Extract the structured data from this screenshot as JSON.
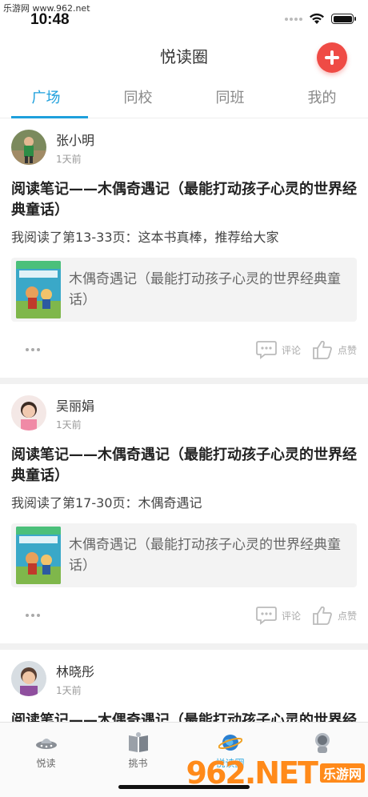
{
  "watermark": {
    "top_text": "乐游网 www.962.net",
    "logo_text": "962.NET",
    "logo_sub": "乐游网"
  },
  "status": {
    "time": "10:48"
  },
  "nav": {
    "title": "悦读圈"
  },
  "tabs": [
    {
      "label": "广场"
    },
    {
      "label": "同校"
    },
    {
      "label": "同班"
    },
    {
      "label": "我的"
    }
  ],
  "posts": [
    {
      "user": "张小明",
      "time": "1天前",
      "title": "阅读笔记——木偶奇遇记（最能打动孩子心灵的世界经典童话）",
      "body": "我阅读了第13-33页：这本书真棒，推荐给大家",
      "book": "木偶奇遇记（最能打动孩子心灵的世界经典童话）",
      "comment_label": "评论",
      "like_label": "点赞"
    },
    {
      "user": "吴丽娟",
      "time": "1天前",
      "title": "阅读笔记——木偶奇遇记（最能打动孩子心灵的世界经典童话）",
      "body": "我阅读了第17-30页：木偶奇遇记",
      "book": "木偶奇遇记（最能打动孩子心灵的世界经典童话）",
      "comment_label": "评论",
      "like_label": "点赞"
    },
    {
      "user": "林晓彤",
      "time": "1天前",
      "title": "阅读笔记——木偶奇遇记（最能打动孩子心灵的世界经典童话）"
    }
  ],
  "tabbar": [
    {
      "label": "悦读",
      "icon": "ufo-icon"
    },
    {
      "label": "挑书",
      "icon": "book-icon"
    },
    {
      "label": "悦读圈",
      "icon": "planet-icon"
    },
    {
      "label": "",
      "icon": "astronaut-icon"
    }
  ],
  "colors": {
    "accent": "#1ea0dc",
    "add_button": "#ef4b45"
  }
}
